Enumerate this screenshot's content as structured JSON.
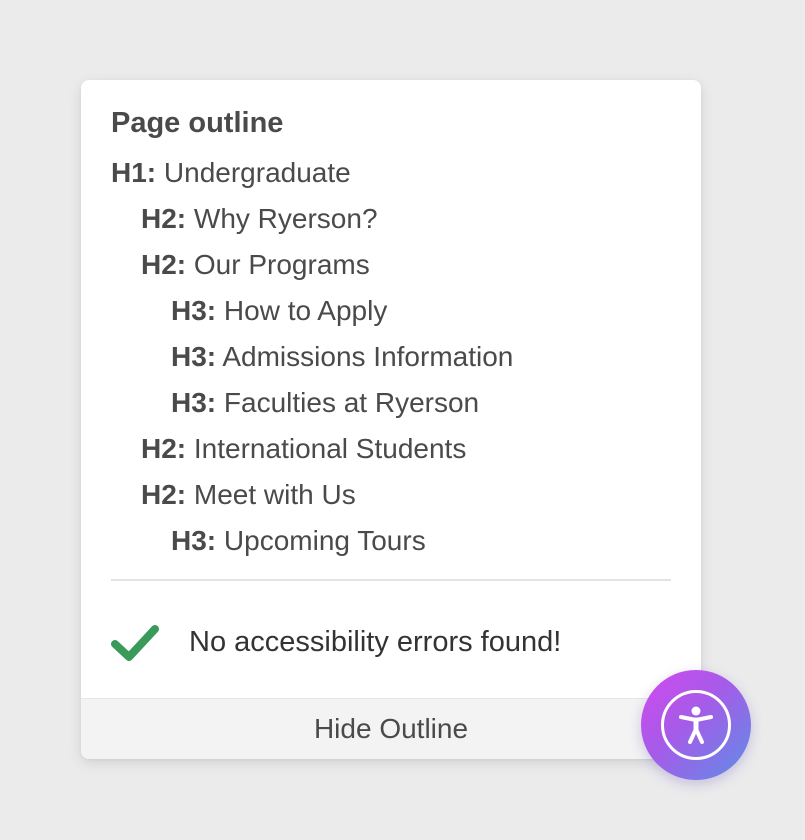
{
  "outline": {
    "title": "Page outline",
    "items": [
      {
        "level": "H1:",
        "text": "Undergraduate",
        "indent": 0
      },
      {
        "level": "H2:",
        "text": "Why Ryerson?",
        "indent": 1
      },
      {
        "level": "H2:",
        "text": "Our Programs",
        "indent": 1
      },
      {
        "level": "H3:",
        "text": "How to Apply",
        "indent": 2
      },
      {
        "level": "H3:",
        "text": "Admissions Information",
        "indent": 2
      },
      {
        "level": "H3:",
        "text": "Faculties at Ryerson",
        "indent": 2
      },
      {
        "level": "H2:",
        "text": "International Students",
        "indent": 1
      },
      {
        "level": "H2:",
        "text": "Meet with Us",
        "indent": 1
      },
      {
        "level": "H3:",
        "text": "Upcoming Tours",
        "indent": 2
      }
    ]
  },
  "status": {
    "icon": "checkmark-icon",
    "text": "No accessibility errors found!",
    "color": "#3a9a5b"
  },
  "footer": {
    "label": "Hide Outline"
  },
  "a11y_button": {
    "icon": "accessibility-person-icon",
    "colors": [
      "#d348f0",
      "#a45ce8",
      "#5f8ee6"
    ]
  }
}
